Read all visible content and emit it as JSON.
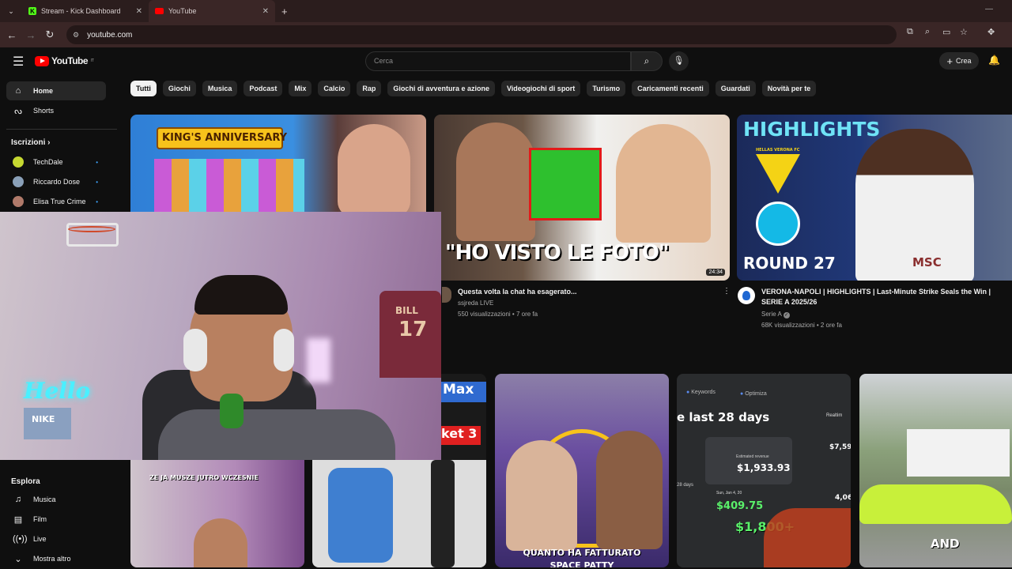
{
  "browser": {
    "tabs": [
      {
        "title": "Stream - Kick Dashboard",
        "favicon": "K"
      },
      {
        "title": "YouTube",
        "favicon": "yt-icon"
      }
    ],
    "new_tab": "+",
    "url": "youtube.com"
  },
  "youtube": {
    "logo": "YouTube",
    "region": "IT",
    "search_placeholder": "Cerca",
    "create_label": "Crea"
  },
  "sidebar": {
    "items": [
      {
        "label": "Home",
        "icon": "home-icon"
      },
      {
        "label": "Shorts",
        "icon": "shorts-icon"
      }
    ],
    "subs_title": "Iscrizioni",
    "subs": [
      {
        "label": "TechDale",
        "color": "#c6d831"
      },
      {
        "label": "Riccardo Dose",
        "color": "#8aa0b8"
      },
      {
        "label": "Elisa True Crime",
        "color": "#b07a6a"
      }
    ],
    "explore_title": "Esplora",
    "explore": [
      {
        "label": "Musica",
        "icon": "music-icon"
      },
      {
        "label": "Film",
        "icon": "film-icon"
      },
      {
        "label": "Live",
        "icon": "live-icon"
      },
      {
        "label": "Mostra altro",
        "icon": "chevron-down-icon"
      }
    ]
  },
  "chips": [
    "Tutti",
    "Giochi",
    "Musica",
    "Podcast",
    "Mix",
    "Calcio",
    "Rap",
    "Giochi di avventura e azione",
    "Videogiochi di sport",
    "Turismo",
    "Caricamenti recenti",
    "Guardati",
    "Novità per te"
  ],
  "videos": [
    {
      "thumb_text": "KING'S ANNIVERSARY"
    },
    {
      "thumb_text": "\"HO VISTO LE FOTO\"",
      "duration": "24:34",
      "title": "Questa volta la chat ha esagerato...",
      "channel": "ssjreda LIVE",
      "meta": "550 visualizzazioni • 7 ore fa"
    },
    {
      "thumb_top": "HIGHLIGHTS",
      "thumb_club": "HELLAS VERONA FC",
      "thumb_round": "ROUND 27",
      "thumb_brand": "MSC",
      "title_line1": "VERONA-NAPOLI | HIGHLIGHTS | Last-Minute Strike Seals the Win |",
      "title_line2": "SERIE A 2025/26",
      "channel": "Serie A",
      "meta": "68K visualizzazioni • 2 ore fa"
    }
  ],
  "shorts": [
    {
      "text1": "Max",
      "text2": "ket 3"
    },
    {
      "text": "QUANTO HA FATTURATO",
      "text2": "SPACE PATTY"
    },
    {
      "tab1": "Keywords",
      "tab2": "Optimiza",
      "line": "e last 28 days",
      "revenue": "$1,933.93",
      "small": "$409.75",
      "big": "$1,800+",
      "side1": "$7,59",
      "side2": "4,06",
      "label_sm": "Estimated revenue",
      "date": "Sun, Jan 4, 20",
      "label_days": "28 days",
      "label_real": "Realtim"
    },
    {
      "text": "AND"
    }
  ],
  "bottom_thumbs": [
    {
      "text": "ZE JA MUSZE JUTRO WCZESNIE"
    }
  ],
  "webcam": {
    "jersey": "BILL",
    "number": "17",
    "neon": "Hello",
    "box": "NIKE"
  }
}
